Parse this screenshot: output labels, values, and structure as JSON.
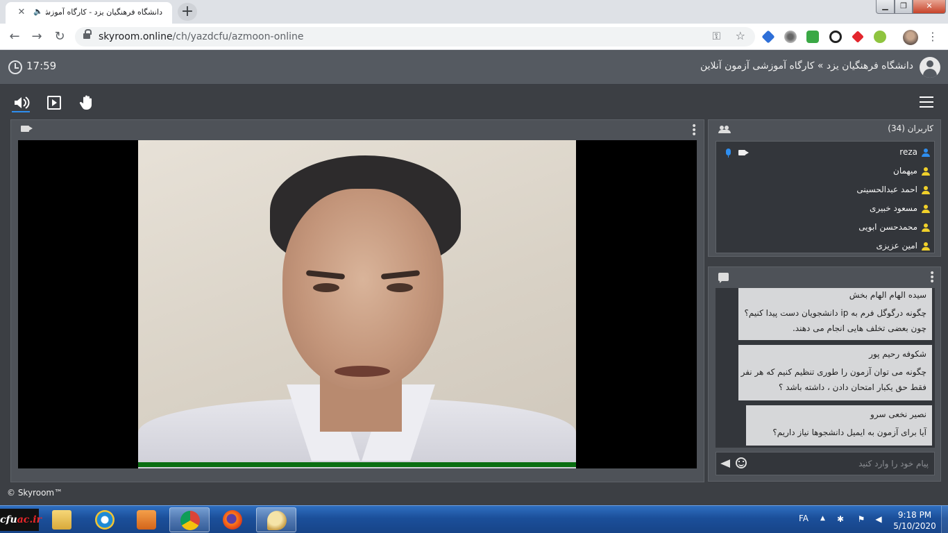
{
  "browser": {
    "tab_title": "دانشگاه فرهنگیان یزد - کارگاه آموزش...",
    "tab_close": "✕",
    "audio_glyph": "🔈",
    "new_tab": "+",
    "url_host": "skyroom.online",
    "url_path": "/ch/yazdcfu/azmoon-online",
    "window_min": "▁",
    "window_max": "❐",
    "window_close": "✕"
  },
  "header": {
    "time": "17:59",
    "title": "دانشگاه فرهنگیان یزد » کارگاه آموزشی آزمون آنلاین"
  },
  "users": {
    "title": "کاربران (34)",
    "list": [
      {
        "name": "reza",
        "color": "#2e8ef0"
      },
      {
        "name": "میهمان",
        "color": "#f0d02a"
      },
      {
        "name": "احمد عبدالحسینی",
        "color": "#f0d02a"
      },
      {
        "name": "مسعود خبیری",
        "color": "#f0d02a"
      },
      {
        "name": "محمدحسن ابویی",
        "color": "#f0d02a"
      },
      {
        "name": "امین عزیزی",
        "color": "#f0d02a"
      }
    ]
  },
  "chat": {
    "messages": [
      {
        "author": "سیده الهام الهام بخش",
        "lines": [
          "چگونه درگوگل فرم به ip دانشجویان دست پیدا کنیم؟",
          "چون بعضی تخلف هایی انجام می دهند."
        ]
      },
      {
        "author": "شکوفه رحیم پور",
        "lines": [
          "چگونه می توان آزمون را طوری تنظیم کنیم که هر نفر",
          "فقط حق یکبار امتحان دادن ، داشته باشد ؟"
        ]
      },
      {
        "author": "نصیر نخعی سرو",
        "lines": [
          "آیا برای آزمون به ایمیل دانشجوها نیاز داریم؟"
        ]
      }
    ],
    "input_placeholder": "پیام خود را وارد کنید"
  },
  "footer": {
    "copyright": "© Skyroom™"
  },
  "taskbar": {
    "logo_main": "cfu",
    "logo_accent": "ac.ir",
    "lang": "FA",
    "tray_arrow": "▲",
    "time": "9:18 PM",
    "date": "5/10/2020"
  },
  "colors": {
    "accent": "#2e8ef0",
    "speaking_indicator": "#0a6e12",
    "guest_user": "#f0d02a"
  }
}
